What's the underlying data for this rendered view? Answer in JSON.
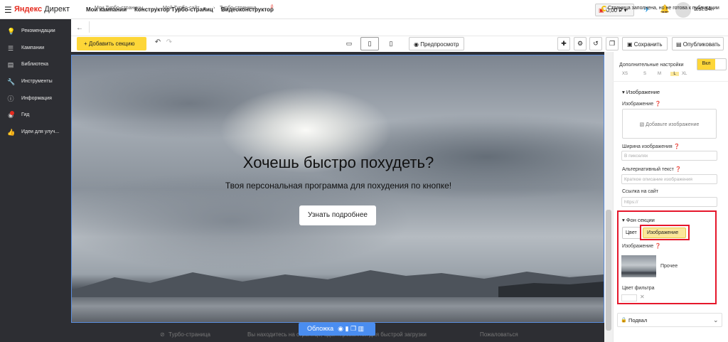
{
  "topbar": {
    "logo_ya": "Яндекс",
    "logo_direct": "Директ",
    "nav": [
      "Мои кампании",
      "Конструктор Турбо-страниц",
      "Видеоконструктор"
    ],
    "balance": "0,00 ₽",
    "user": "test.d4r"
  },
  "sidebar": {
    "items": [
      {
        "label": "Рекомендации",
        "icon": "lightbulb-icon"
      },
      {
        "label": "Кампании",
        "icon": "list-icon"
      },
      {
        "label": "Библиотека",
        "icon": "library-icon"
      },
      {
        "label": "Инструменты",
        "icon": "wrench-icon"
      },
      {
        "label": "Информация",
        "icon": "info-icon"
      },
      {
        "label": "Гид",
        "icon": "guide-icon"
      },
      {
        "label": "Идеи для улуч...",
        "icon": "thumbs-up-icon"
      }
    ]
  },
  "breadcrumb": {
    "items": [
      "Мои Турбо-страницы",
      "Мой Турбо-сайт",
      "Турбо-страница"
    ],
    "status": "Страница заполнена, но не готова к публикации"
  },
  "toolbar": {
    "add_section": "+ Добавить секцию",
    "preview": "Предпросмотр",
    "save": "Сохранить",
    "publish": "Опубликовать"
  },
  "hero": {
    "title": "Хочешь быстро похудеть?",
    "subtitle": "Твоя персональная программа для похудения по кнопке!",
    "button": "Узнать подробнее"
  },
  "footer": {
    "turbo": "Турбо-страница",
    "notice": "Вы находитесь на странице, адаптированной для быстрой загрузки",
    "complain": "Пожаловаться",
    "cover_tab": "Обложка"
  },
  "panel": {
    "extra_settings": "Дополнительные настройки",
    "toggle_on": "Вкл",
    "sizes": [
      "XS",
      "S",
      "M",
      "L",
      "XL"
    ],
    "image_section": "Изображение",
    "image_label": "Изображение",
    "add_image": "Добавьте изображение",
    "width_label": "Ширина изображения",
    "width_placeholder": "В пикселях",
    "alt_label": "Альтернативный текст",
    "alt_placeholder": "Краткое описание изображения",
    "link_label": "Ссылка на сайт",
    "link_placeholder": "https://",
    "bg_section": "Фон секции",
    "bg_color": "Цвет",
    "bg_image": "Изображение",
    "bg_image_label": "Изображение",
    "other": "Прочее",
    "filter_color": "Цвет фильтра",
    "footer_section": "Подвал"
  }
}
